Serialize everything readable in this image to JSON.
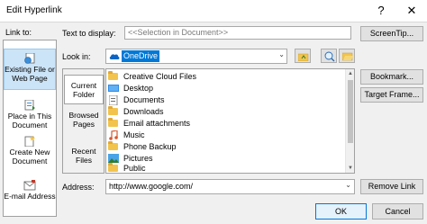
{
  "window": {
    "title": "Edit Hyperlink",
    "help_glyph": "?",
    "close_glyph": "✕"
  },
  "link_to": {
    "label": "Link to:",
    "items": [
      {
        "label": "Existing File or Web Page",
        "icon": "globe-page-icon",
        "selected": true
      },
      {
        "label": "Place in This Document",
        "icon": "document-place-icon",
        "selected": false
      },
      {
        "label": "Create New Document",
        "icon": "new-document-icon",
        "selected": false
      },
      {
        "label": "E-mail Address",
        "icon": "email-icon",
        "selected": false
      }
    ]
  },
  "text_to_display": {
    "label": "Text to display:",
    "value": "<<Selection in Document>>"
  },
  "screentip_button": "ScreenTip...",
  "look_in": {
    "label": "Look in:",
    "value": "OneDrive",
    "icon": "onedrive-cloud-icon"
  },
  "browse": {
    "items": [
      {
        "label": "Current Folder",
        "selected": true
      },
      {
        "label": "Browsed Pages",
        "selected": false
      },
      {
        "label": "Recent Files",
        "selected": false
      }
    ]
  },
  "files": [
    {
      "name": "Creative Cloud Files",
      "icon": "folder-icon"
    },
    {
      "name": "Desktop",
      "icon": "desktop-folder-icon"
    },
    {
      "name": "Documents",
      "icon": "documents-folder-icon"
    },
    {
      "name": "Downloads",
      "icon": "folder-icon"
    },
    {
      "name": "Email attachments",
      "icon": "folder-icon"
    },
    {
      "name": "Music",
      "icon": "music-folder-icon"
    },
    {
      "name": "Phone Backup",
      "icon": "folder-icon"
    },
    {
      "name": "Pictures",
      "icon": "pictures-folder-icon"
    },
    {
      "name": "Public",
      "icon": "folder-icon"
    }
  ],
  "side_buttons": {
    "bookmark": "Bookmark...",
    "target_frame": "Target Frame...",
    "remove_link": "Remove Link"
  },
  "address": {
    "label": "Address:",
    "value": "http://www.google.com/"
  },
  "footer": {
    "ok": "OK",
    "cancel": "Cancel"
  },
  "colors": {
    "accent": "#0078d7",
    "selection_bg": "#cce4f7",
    "folder": "#f2c44d"
  }
}
